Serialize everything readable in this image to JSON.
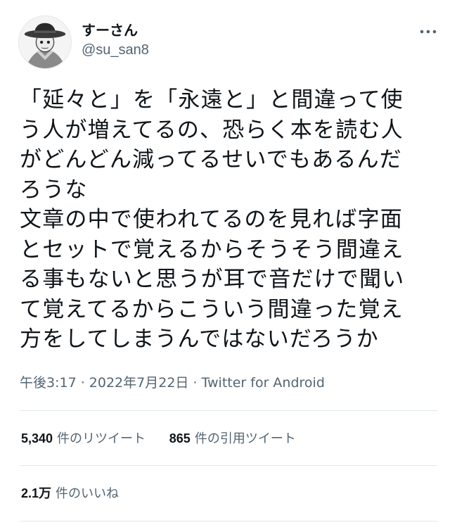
{
  "user": {
    "display_name": "すーさん",
    "handle": "@su_san8"
  },
  "tweet": {
    "lines": [
      "「延々と」を「永遠と」と間違って使",
      "う人が増えてるの、恐らく本を読む人",
      "がどんどん減ってるせいでもあるんだ",
      "ろうな",
      "文章の中で使われてるのを見れば字面",
      "とセットで覚えるからそうそう間違え",
      "る事もないと思うが耳で音だけで聞い",
      "て覚えてるからこういう間違った覚え",
      "方をしてしまうんではないだろうか"
    ],
    "time": "午後3:17",
    "separator1": " · ",
    "date": "2022年7月22日",
    "separator2": " · ",
    "source": "Twitter for Android"
  },
  "stats": {
    "retweets_count": "5,340",
    "retweets_label": "件のリツイート",
    "quotes_count": "865",
    "quotes_label": "件の引用ツイート",
    "likes_count": "2.1万",
    "likes_label": "件のいいね"
  },
  "icons": {
    "more": "more-horizontal-icon",
    "avatar": "detective-avatar-image"
  },
  "colors": {
    "text_primary": "#0f1419",
    "text_secondary": "#536471",
    "divider": "#e1e8ed"
  }
}
